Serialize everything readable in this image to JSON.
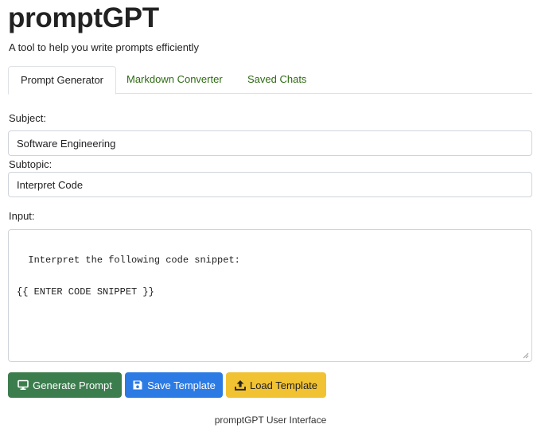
{
  "app": {
    "title": "promptGPT",
    "subtitle": "A tool to help you write prompts efficiently"
  },
  "tabs": [
    {
      "label": "Prompt Generator",
      "active": true
    },
    {
      "label": "Markdown Converter",
      "active": false
    },
    {
      "label": "Saved Chats",
      "active": false
    }
  ],
  "form": {
    "subject_label": "Subject:",
    "subject_value": "Software Engineering",
    "subtopic_label": "Subtopic:",
    "subtopic_value": "Interpret Code",
    "input_label": "Input:",
    "input_value": "Interpret the following code snippet:\n\n{{ ENTER CODE SNIPPET }}"
  },
  "buttons": {
    "generate_label": "Generate Prompt",
    "save_label": "Save Template",
    "load_label": "Load Template"
  },
  "icons": {
    "generate": "monitor-icon",
    "save": "floppy-disk-icon",
    "load": "upload-icon"
  },
  "colors": {
    "tab_link": "#2e6b12",
    "generate_bg": "#3c7d4e",
    "save_bg": "#2c7be5",
    "load_bg": "#f1c232"
  },
  "footer": {
    "caption": "promptGPT User Interface"
  }
}
